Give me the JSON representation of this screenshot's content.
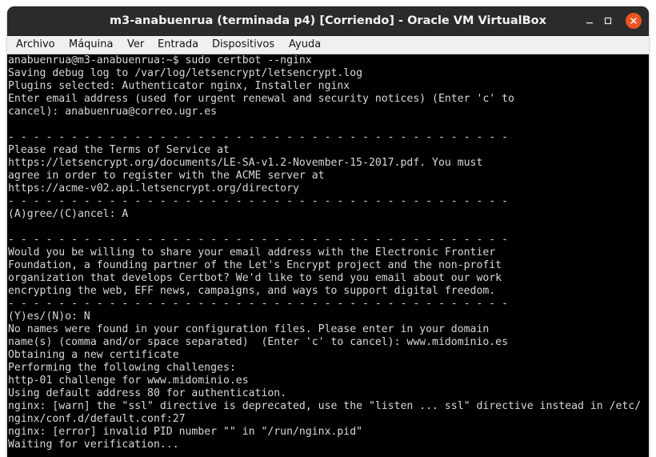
{
  "window": {
    "title": "m3-anabuenrua (terminada p4) [Corriendo] - Oracle VM VirtualBox",
    "controls": {
      "minimize_icon": "minimize-icon",
      "maximize_icon": "maximize-icon",
      "close_icon": "close-icon",
      "close_color": "#e95420"
    }
  },
  "menubar": {
    "items": [
      "Archivo",
      "Máquina",
      "Ver",
      "Entrada",
      "Dispositivos",
      "Ayuda"
    ]
  },
  "terminal": {
    "background": "#000000",
    "foreground": "#d9d9d9",
    "lines": [
      "anabuenrua@m3-anabuenrua:~$ sudo certbot --nginx",
      "Saving debug log to /var/log/letsencrypt/letsencrypt.log",
      "Plugins selected: Authenticator nginx, Installer nginx",
      "Enter email address (used for urgent renewal and security notices) (Enter 'c' to",
      "cancel): anabuenrua@correo.ugr.es",
      "",
      "- - - - - - - - - - - - - - - - - - - - - - - - - - - - - - - - - - - - - - - -",
      "Please read the Terms of Service at",
      "https://letsencrypt.org/documents/LE-SA-v1.2-November-15-2017.pdf. You must",
      "agree in order to register with the ACME server at",
      "https://acme-v02.api.letsencrypt.org/directory",
      "- - - - - - - - - - - - - - - - - - - - - - - - - - - - - - - - - - - - - - - -",
      "(A)gree/(C)ancel: A",
      "",
      "- - - - - - - - - - - - - - - - - - - - - - - - - - - - - - - - - - - - - - - -",
      "Would you be willing to share your email address with the Electronic Frontier",
      "Foundation, a founding partner of the Let's Encrypt project and the non-profit",
      "organization that develops Certbot? We'd like to send you email about our work",
      "encrypting the web, EFF news, campaigns, and ways to support digital freedom.",
      "- - - - - - - - - - - - - - - - - - - - - - - - - - - - - - - - - - - - - - - -",
      "(Y)es/(N)o: N",
      "No names were found in your configuration files. Please enter in your domain",
      "name(s) (comma and/or space separated)  (Enter 'c' to cancel): www.midominio.es",
      "Obtaining a new certificate",
      "Performing the following challenges:",
      "http-01 challenge for www.midominio.es",
      "Using default address 80 for authentication.",
      "nginx: [warn] the \"ssl\" directive is deprecated, use the \"listen ... ssl\" directive instead in /etc/",
      "nginx/conf.d/default.conf:27",
      "nginx: [error] invalid PID number \"\" in \"/run/nginx.pid\"",
      "Waiting for verification..."
    ]
  }
}
